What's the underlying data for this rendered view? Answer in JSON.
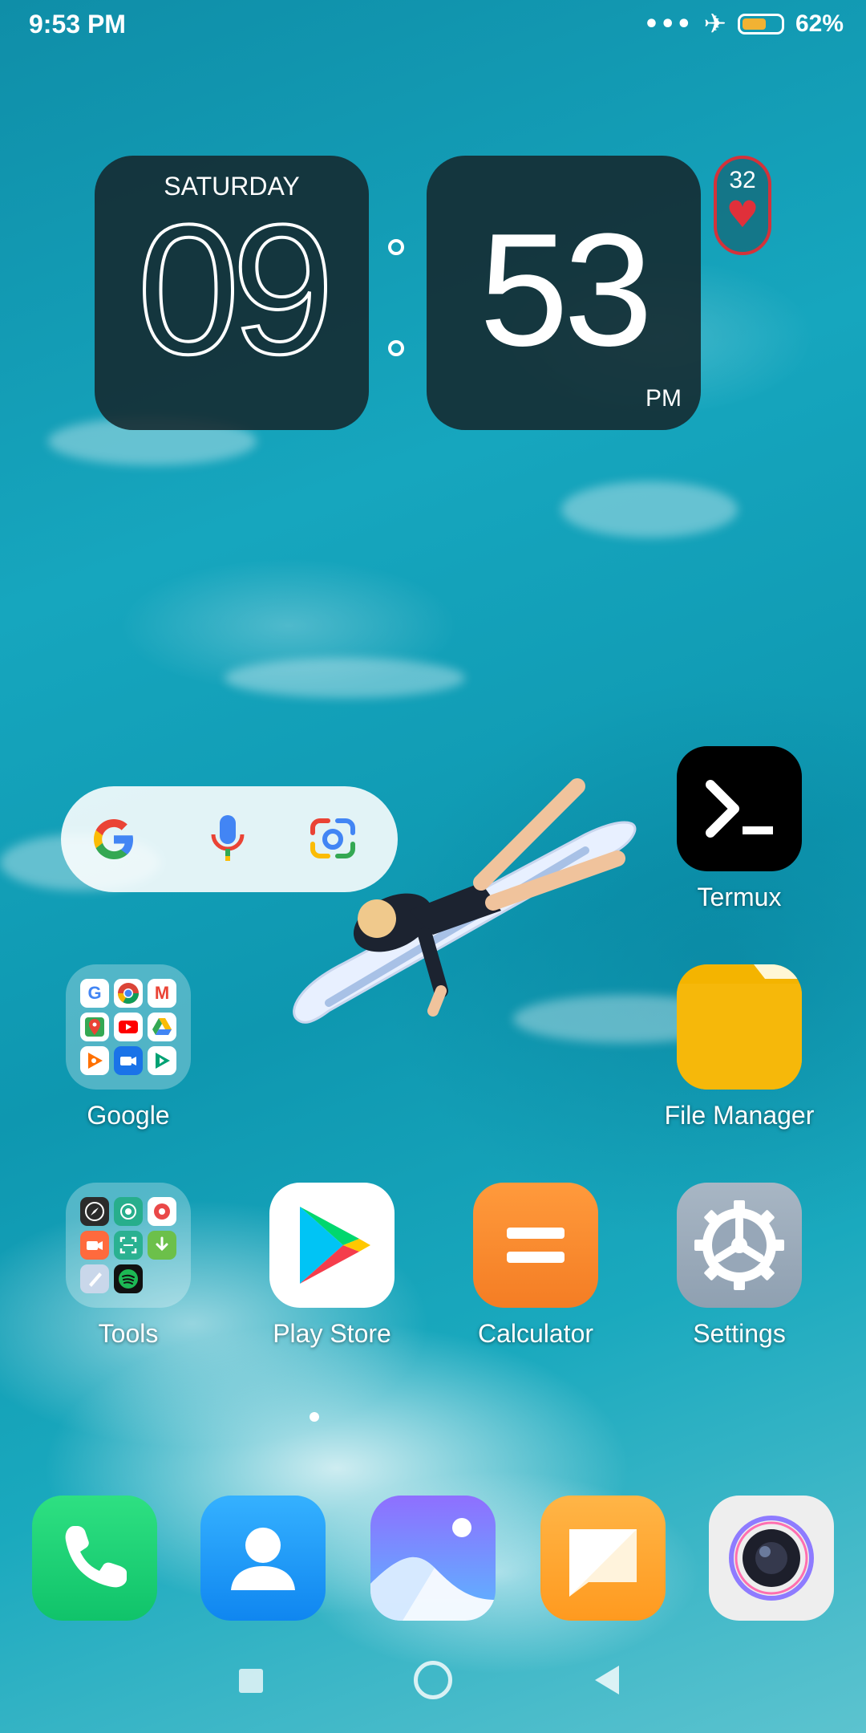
{
  "status_bar": {
    "time": "9:53 PM",
    "more_icon": "•••",
    "airplane_icon": "airplane-icon",
    "battery_percent": "62%",
    "battery_level": 0.62,
    "battery_color": "#f2b233"
  },
  "clock_widget": {
    "weekday": "SATURDAY",
    "hours": "09",
    "minutes": "53",
    "ampm": "PM"
  },
  "heart_widget": {
    "count": "32",
    "icon": "heart-icon",
    "color": "#e0303a"
  },
  "search_widget": {
    "icons": [
      "google-logo-icon",
      "microphone-icon",
      "google-lens-icon"
    ]
  },
  "apps": {
    "termux": "Termux",
    "file_manager": "File Manager",
    "google_folder": "Google",
    "tools_folder": "Tools",
    "play_store": "Play Store",
    "calculator": "Calculator",
    "settings": "Settings"
  },
  "dock": [
    "phone-icon",
    "contacts-icon",
    "gallery-icon",
    "messages-icon",
    "camera-icon"
  ],
  "nav_bar": [
    "recents-icon",
    "home-icon",
    "back-icon"
  ]
}
